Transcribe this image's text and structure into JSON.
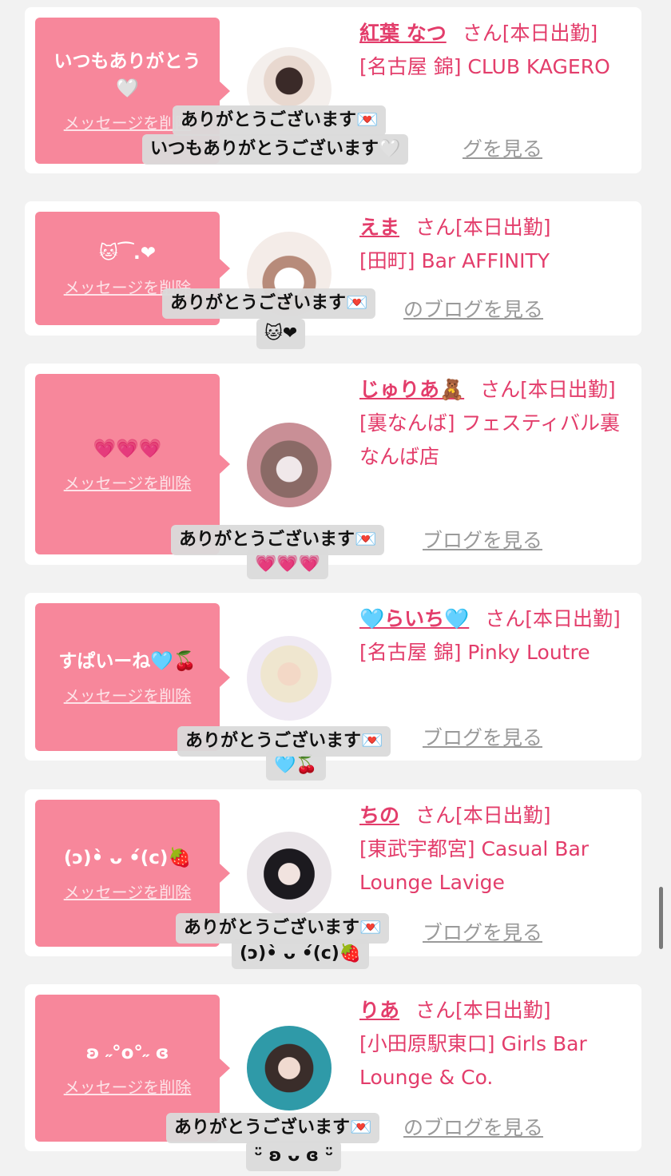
{
  "colors": {
    "accent": "#e33d6b",
    "bubble": "#f7879b",
    "link_gray": "#9a9a9a"
  },
  "cards": [
    {
      "message": "いつもありがとう🤍",
      "delete_label": "メッセージを削除",
      "name": "紅葉 なつ",
      "san": "さん[本日出勤]",
      "shop": "[名古屋 錦] CLUB KAGERO",
      "blog": "グを見る",
      "toast_line1": "ありがとうございます💌",
      "toast_line2": "いつもありがとうございます🤍"
    },
    {
      "message": "🐱⁀.❤",
      "delete_label": "メッセージを削除",
      "name": "えま",
      "san": "さん[本日出勤]",
      "shop": "[田町] Bar AFFINITY",
      "blog": "のブログを見る",
      "toast_line1": "ありがとうございます💌",
      "toast_line2": "🐱❤"
    },
    {
      "message": "💗💗💗",
      "delete_label": "メッセージを削除",
      "name": "じゅりあ🧸",
      "san": "さん[本日出勤]",
      "shop": "[裏なんば] フェスティバル裏なんば店",
      "blog": "ブログを見る",
      "toast_line1": "ありがとうございます💌",
      "toast_line2": "💗💗💗"
    },
    {
      "message": "すぱいーね🩵🍒",
      "delete_label": "メッセージを削除",
      "name": "🩵らいち🩵",
      "san": "さん[本日出勤]",
      "shop": "[名古屋 錦] Pinky Loutre",
      "blog": "ブログを見る",
      "toast_line1": "ありがとうございます💌",
      "toast_line2": "🩵🍒"
    },
    {
      "message": "(ɔ)•̀ ᴗ •́(c)🍓",
      "delete_label": "メッセージを削除",
      "name": "ちの",
      "san": "さん[本日出勤]",
      "shop": "[東武宇都宮] Casual Bar Lounge Lavige",
      "blog": "ブログを見る",
      "toast_line1": "ありがとうございます💌",
      "toast_line2": "(ɔ)•̀ ᴗ •́(c)🍓"
    },
    {
      "message": "ʚ ˶°o°˶ ɞ",
      "delete_label": "メッセージを削除",
      "name": "りあ",
      "san": "さん[本日出勤]",
      "shop": "[小田原駅東口] Girls Bar Lounge & Co.",
      "blog": "のブログを見る",
      "toast_line1": "ありがとうございます💌",
      "toast_line2": "ᵕ̈ ʚ ᴗ ɞ ᵕ̈"
    }
  ]
}
